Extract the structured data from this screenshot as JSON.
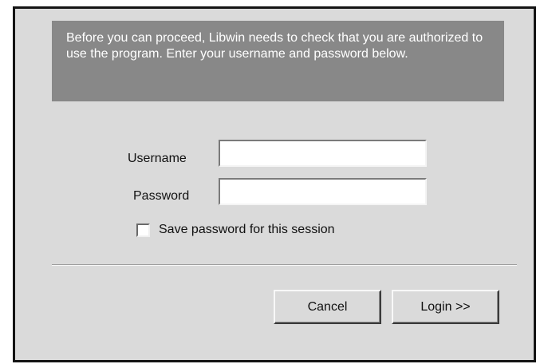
{
  "notice": {
    "text": "Before you can proceed, Libwin needs to check that you are authorized to use the program. Enter your username and password below."
  },
  "form": {
    "username_label": "Username",
    "username_value": "",
    "password_label": "Password",
    "password_value": "",
    "save_password_label": "Save password for this session",
    "save_password_checked": false
  },
  "buttons": {
    "cancel_label": "Cancel",
    "login_label": "Login >>"
  },
  "colors": {
    "dialog_background": "#dadada",
    "notice_background": "#888888",
    "notice_text": "#ffffff",
    "frame_border": "#141414"
  }
}
